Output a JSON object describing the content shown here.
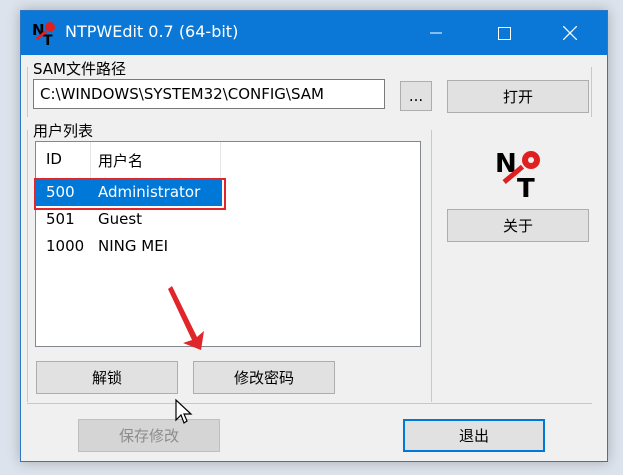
{
  "window": {
    "title": "NTPWEdit 0.7 (64-bit)"
  },
  "sam": {
    "label": "SAM文件路径",
    "path_value": "C:\\WINDOWS\\SYSTEM32\\CONFIG\\SAM",
    "browse_label": "...",
    "open_label": "打开"
  },
  "users": {
    "label": "用户列表",
    "columns": [
      "ID",
      "用户名"
    ],
    "rows": [
      {
        "id": "500",
        "name": "Administrator",
        "selected": true
      },
      {
        "id": "501",
        "name": "Guest",
        "selected": false
      },
      {
        "id": "1000",
        "name": "NING MEI",
        "selected": false
      }
    ],
    "unlock_label": "解锁",
    "change_password_label": "修改密码"
  },
  "side": {
    "about_label": "关于"
  },
  "footer": {
    "save_label": "保存修改",
    "exit_label": "退出"
  },
  "colors": {
    "titlebar": "#0b78d7",
    "selection": "#0078d7",
    "annotation_red": "#e0262b"
  },
  "icons": [
    "app-logo-icon",
    "minimize-icon",
    "maximize-icon",
    "close-icon",
    "arrow-annotation-icon",
    "mouse-cursor-icon"
  ]
}
